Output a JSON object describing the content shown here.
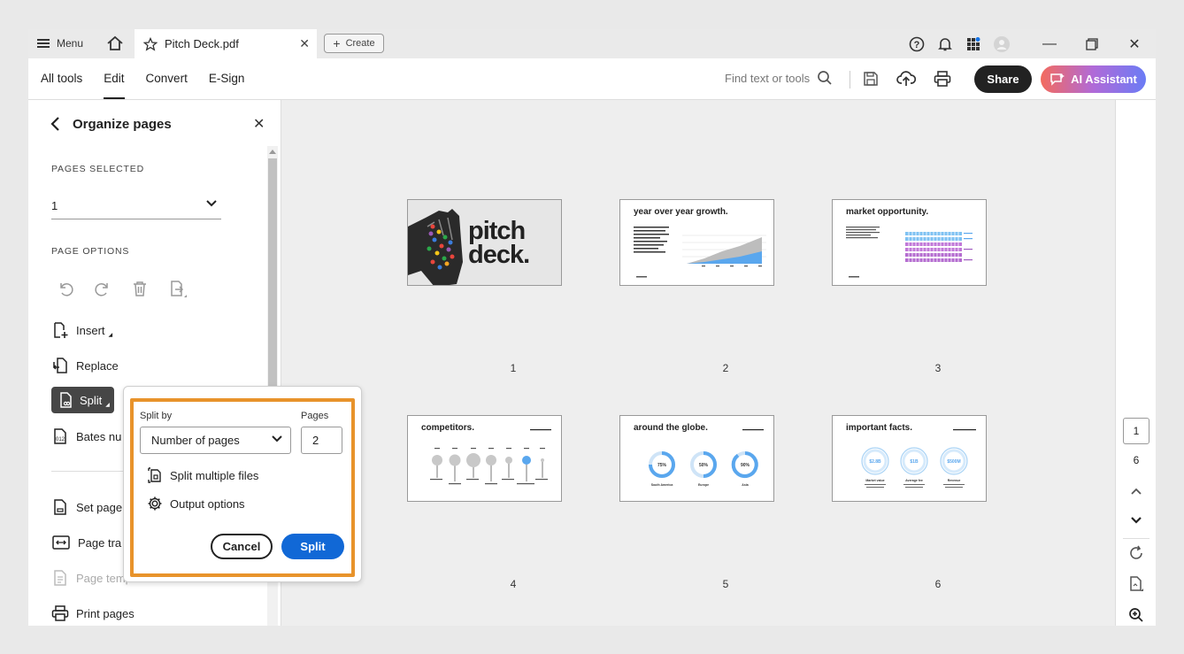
{
  "titlebar": {
    "menu_label": "Menu",
    "tab_title": "Pitch Deck.pdf",
    "create_label": "Create"
  },
  "toolbar": {
    "nav": [
      "All tools",
      "Edit",
      "Convert",
      "E-Sign"
    ],
    "active_nav": "Edit",
    "search_placeholder": "Find text or tools",
    "share_label": "Share",
    "ai_label": "AI Assistant"
  },
  "panel": {
    "title": "Organize pages",
    "pages_selected_label": "PAGES SELECTED",
    "pages_selected_value": "1",
    "page_options_label": "PAGE OPTIONS",
    "items": {
      "insert": "Insert",
      "replace": "Replace",
      "split": "Split",
      "bates": "Bates nu",
      "set_page": "Set page",
      "page_transitions": "Page tra",
      "page_templates": "Page templates",
      "print_pages": "Print pages"
    }
  },
  "split_popup": {
    "split_by_label": "Split by",
    "split_by_value": "Number of pages",
    "pages_label": "Pages",
    "pages_value": "2",
    "split_multiple": "Split multiple files",
    "output_options": "Output options",
    "cancel_label": "Cancel",
    "split_label": "Split"
  },
  "thumbnails": [
    {
      "num": "1",
      "title": "pitch deck."
    },
    {
      "num": "2",
      "title": "year over year growth."
    },
    {
      "num": "3",
      "title": "market opportunity."
    },
    {
      "num": "4",
      "title": "competitors."
    },
    {
      "num": "5",
      "title": "around the globe."
    },
    {
      "num": "6",
      "title": "important facts."
    }
  ],
  "slide5": {
    "values": [
      "75%",
      "50%",
      "90%"
    ],
    "labels": [
      "South America",
      "Europe",
      "Asia"
    ]
  },
  "slide6": {
    "values": [
      "$2.8B",
      "$1B",
      "$500M"
    ],
    "labels": [
      "Market value",
      "Average fee",
      "Revenue"
    ]
  },
  "rail": {
    "current_page": "1",
    "total_pages": "6"
  },
  "colors": {
    "accent_blue": "#1168d6",
    "highlight_orange": "#e8932b",
    "share_bg": "#222222"
  }
}
